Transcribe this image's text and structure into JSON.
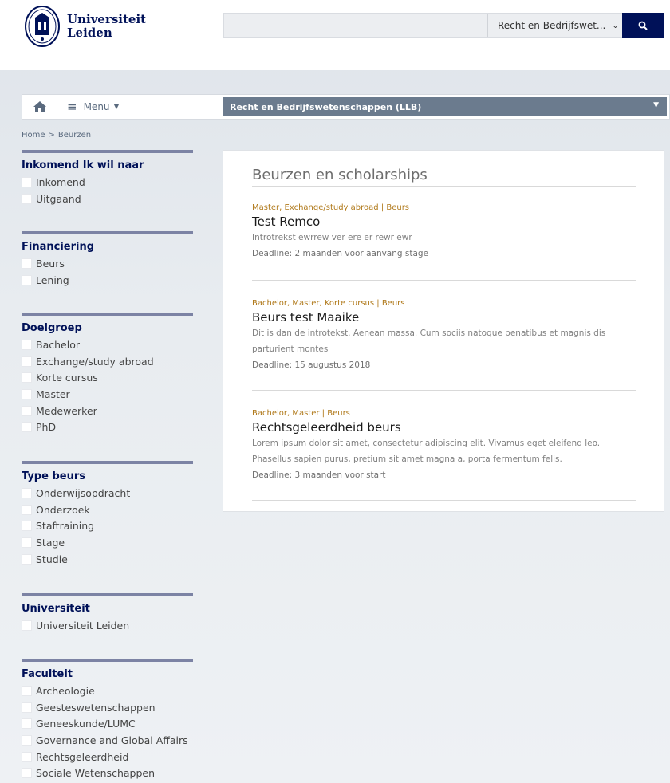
{
  "brand": {
    "name_line1": "Universiteit",
    "name_line2": "Leiden",
    "color": "#001158"
  },
  "search": {
    "placeholder": "",
    "scope_value": "Recht en Bedrijfswet...",
    "button_icon": "search-icon"
  },
  "nav": {
    "home_icon": "home-icon",
    "menu_label": "Menu",
    "faculty_selected": "Recht en Bedrijfswetenschappen (LLB)",
    "faculty_bg": "#6b7b8e"
  },
  "breadcrumb": {
    "home": "Home",
    "separator": ">",
    "current": "Beurzen"
  },
  "filters": [
    {
      "title": "Inkomend Ik wil naar",
      "items": [
        "Inkomend",
        "Uitgaand"
      ]
    },
    {
      "title": "Financiering",
      "items": [
        "Beurs",
        "Lening"
      ]
    },
    {
      "title": "Doelgroep",
      "items": [
        "Bachelor",
        "Exchange/study abroad",
        "Korte cursus",
        "Master",
        "Medewerker",
        "PhD"
      ]
    },
    {
      "title": "Type beurs",
      "items": [
        "Onderwijsopdracht",
        "Onderzoek",
        "Staftraining",
        "Stage",
        "Studie"
      ]
    },
    {
      "title": "Universiteit",
      "items": [
        "Universiteit Leiden"
      ]
    },
    {
      "title": "Faculteit",
      "items": [
        "Archeologie",
        "Geesteswetenschappen",
        "Geneeskunde/LUMC",
        "Governance and Global Affairs",
        "Rechtsgeleerdheid",
        "Sociale Wetenschappen"
      ]
    }
  ],
  "main": {
    "title": "Beurzen en scholarships",
    "results": [
      {
        "tags": "Master, Exchange/study abroad | Beurs",
        "title": "Test Remco",
        "intro": "Introtrekst ewrrew ver ere er rewr ewr",
        "deadline": "Deadline: 2 maanden voor aanvang stage"
      },
      {
        "tags": "Bachelor, Master, Korte cursus | Beurs",
        "title": "Beurs test Maaike",
        "intro": "Dit is dan de introtekst. Aenean massa. Cum sociis natoque penatibus et magnis dis parturient montes",
        "deadline": "Deadline: 15 augustus 2018"
      },
      {
        "tags": "Bachelor, Master | Beurs",
        "title": "Rechtsgeleerdheid beurs",
        "intro": "Lorem ipsum dolor sit amet, consectetur adipiscing elit. Vivamus eget eleifend leo. Phasellus sapien purus, pretium sit amet magna a, porta fermentum felis.",
        "deadline": "Deadline: 3 maanden voor start"
      }
    ]
  },
  "colors": {
    "tag": "#b0791a",
    "filter_bar": "#7c83a4",
    "navy": "#001158"
  }
}
